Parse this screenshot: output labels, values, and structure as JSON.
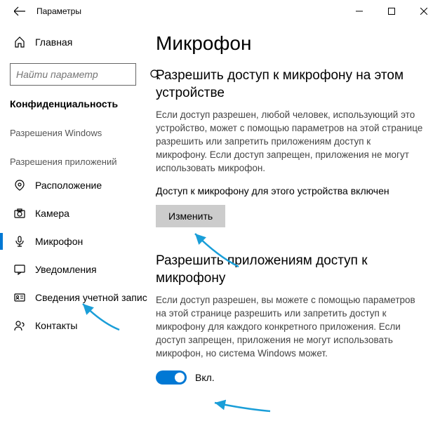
{
  "window": {
    "title": "Параметры"
  },
  "sidebar": {
    "home": "Главная",
    "search_placeholder": "Найти параметр",
    "category": "Конфиденциальность",
    "group1": "Разрешения Windows",
    "group2": "Разрешения приложений",
    "items": {
      "location": "Расположение",
      "camera": "Камера",
      "microphone": "Микрофон",
      "notifications": "Уведомления",
      "account_info": "Сведения учетной записи",
      "contacts": "Контакты"
    }
  },
  "content": {
    "title": "Микрофон",
    "section1": {
      "heading": "Разрешить доступ к микрофону на этом устройстве",
      "desc": "Если доступ разрешен, любой человек, использующий это устройство, может с помощью параметров на этой странице разрешить или запретить приложениям доступ к микрофону. Если доступ запрещен, приложения не могут использовать микрофон.",
      "status": "Доступ к микрофону для этого устройства включен",
      "button": "Изменить"
    },
    "section2": {
      "heading": "Разрешить приложениям доступ к микрофону",
      "desc": "Если доступ разрешен, вы можете с помощью параметров на этой странице разрешить или запретить доступ к микрофону для каждого конкретного приложения. Если доступ запрещен, приложения не могут использовать микрофон, но система Windows может.",
      "toggle_label": "Вкл."
    }
  }
}
